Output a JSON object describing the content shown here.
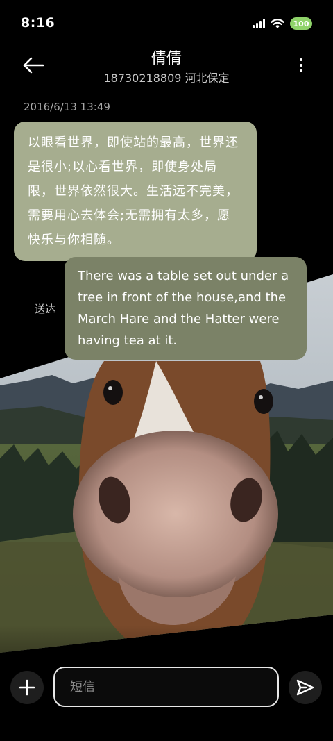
{
  "status_bar": {
    "time": "8:16",
    "battery": "100",
    "icons": [
      "signal-icon",
      "wifi-icon",
      "battery-icon"
    ]
  },
  "header": {
    "contact_name": "倩倩",
    "contact_detail": "18730218809 河北保定",
    "icons": [
      "back-arrow-icon",
      "more-vertical-icon"
    ]
  },
  "conversation": {
    "timestamp": "2016/6/13 13:49",
    "incoming_message": "以眼看世界，即使站的最高，世界还是很小;以心看世界，即使身处局限，世界依然很大。生活远不完美，需要用心去体会;无需拥有太多，愿快乐与你相随。",
    "outgoing_message": "There was a table set out under a tree in front of the house,and the March Hare and the Hatter were having tea at it.",
    "outgoing_status": "送达"
  },
  "composer": {
    "placeholder": "短信",
    "value": "",
    "icons": [
      "plus-icon",
      "send-icon"
    ]
  },
  "colors": {
    "incoming_bubble": "#a6ad8f",
    "outgoing_bubble": "#7b8267",
    "background": "#000000",
    "battery": "#8fd36a"
  }
}
